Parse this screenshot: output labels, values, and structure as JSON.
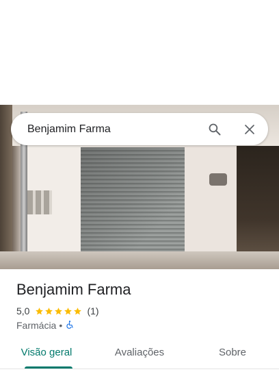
{
  "search": {
    "value": "Benjamim Farma",
    "search_icon": "search-icon",
    "close_icon": "close-icon"
  },
  "place": {
    "name": "Benjamim Farma",
    "rating": "5,0",
    "stars": 5,
    "review_count": "(1)",
    "category": "Farmácia",
    "separator": "•",
    "accessibility_icon": "wheelchair-icon"
  },
  "tabs": [
    {
      "label": "Visão geral",
      "active": true
    },
    {
      "label": "Avaliações",
      "active": false
    },
    {
      "label": "Sobre",
      "active": false
    }
  ],
  "colors": {
    "accent": "#00796b",
    "star": "#fbbc04",
    "accessibility": "#1a73e8"
  }
}
